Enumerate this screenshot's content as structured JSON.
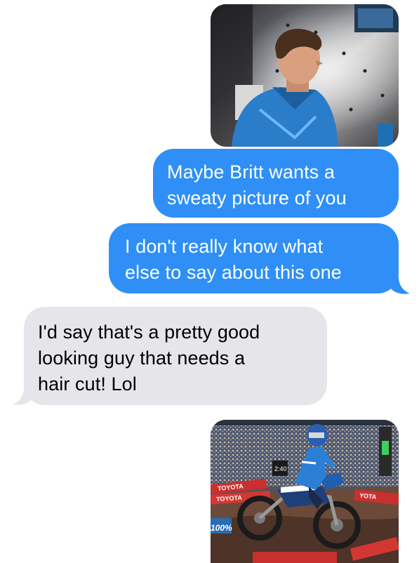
{
  "thread": {
    "messages": [
      {
        "from": "me",
        "kind": "photo",
        "subject": "rider portrait in blue jersey"
      },
      {
        "from": "me",
        "kind": "text",
        "lines": [
          "Maybe Britt wants a",
          "sweaty picture of you"
        ]
      },
      {
        "from": "me",
        "kind": "text",
        "lines": [
          "I don't really know what",
          "else to say about this one"
        ]
      },
      {
        "from": "them",
        "kind": "text",
        "lines": [
          "I'd say that's a pretty good",
          "looking guy that needs a",
          "hair cut! Lol"
        ]
      },
      {
        "from": "me",
        "kind": "photo",
        "subject": "supercross rider on dirt bike in stadium"
      }
    ]
  },
  "photo2": {
    "banner_text_1": "TOYOTA",
    "banner_text_2": "TOYOTA",
    "banner_text_3": "YOTA",
    "board_text": "2:40",
    "corner_text": "100%"
  },
  "colors": {
    "sent_bubble": "#2f8ff6",
    "received_bubble": "#e5e5ea",
    "sent_text": "#ffffff",
    "received_text": "#000000"
  }
}
